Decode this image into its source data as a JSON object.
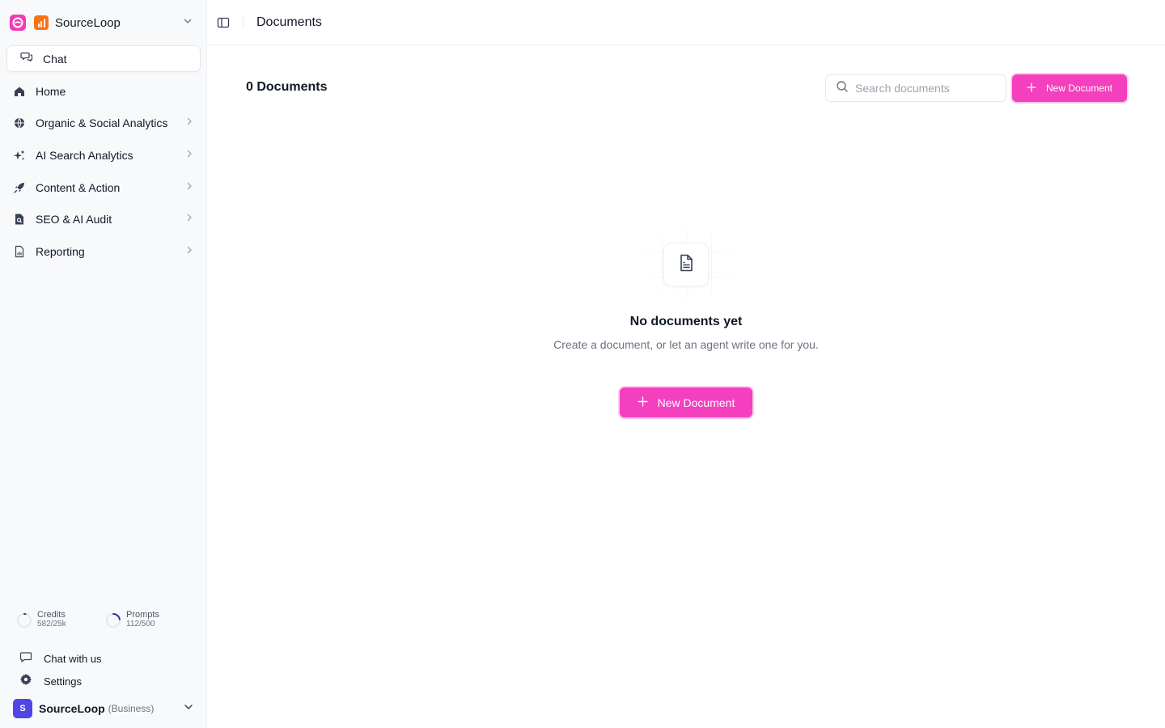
{
  "workspace": {
    "name": "SourceLoop"
  },
  "sidebar": {
    "chat_label": "Chat",
    "items": [
      {
        "label": "Home",
        "icon": "home-icon",
        "has_children": false
      },
      {
        "label": "Organic & Social Analytics",
        "icon": "globe-icon",
        "has_children": true
      },
      {
        "label": "AI Search Analytics",
        "icon": "sparkles-icon",
        "has_children": true
      },
      {
        "label": "Content & Action",
        "icon": "rocket-icon",
        "has_children": true
      },
      {
        "label": "SEO & AI Audit",
        "icon": "file-search-icon",
        "has_children": true
      },
      {
        "label": "Reporting",
        "icon": "report-icon",
        "has_children": true
      }
    ],
    "usage": {
      "credits": {
        "label": "Credits",
        "value": "582/25k",
        "fraction": 0.023
      },
      "prompts": {
        "label": "Prompts",
        "value": "112/500",
        "fraction": 0.224
      }
    },
    "footer": {
      "chat_with_us": "Chat with us",
      "settings": "Settings"
    },
    "account": {
      "initial": "S",
      "name": "SourceLoop",
      "plan": "(Business)"
    }
  },
  "header": {
    "title": "Documents"
  },
  "main": {
    "count_label": "0 Documents",
    "search_placeholder": "Search documents",
    "new_button_label": "New Document",
    "empty": {
      "title": "No documents yet",
      "description": "Create a document, or let an agent write one for you.",
      "button_label": "New Document"
    }
  },
  "colors": {
    "accent": "#f43fbe",
    "avatar": "#4f46e5",
    "project_icon": "#f97316",
    "sidebar_bg": "#f8f9fb"
  }
}
